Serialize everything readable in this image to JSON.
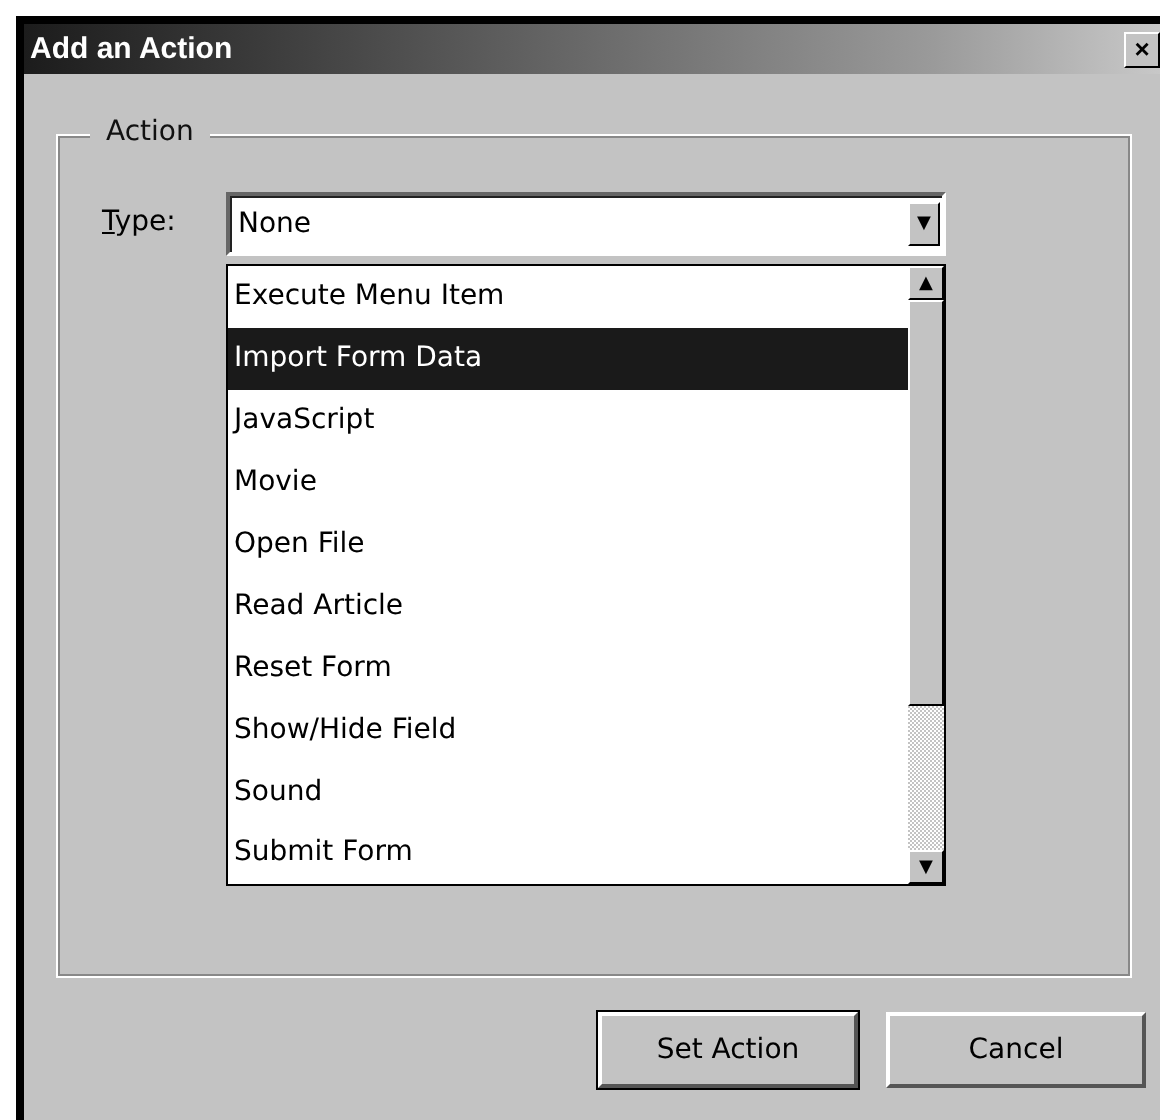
{
  "window": {
    "title": "Add an Action",
    "close": "×"
  },
  "group": {
    "legend": "Action"
  },
  "type_field": {
    "label": "Type:",
    "value": "None",
    "arrow": "▼"
  },
  "dropdown": {
    "up": "▲",
    "down": "▼",
    "items": [
      {
        "label": "Execute Menu Item",
        "selected": false
      },
      {
        "label": "Import Form Data",
        "selected": true
      },
      {
        "label": "JavaScript",
        "selected": false
      },
      {
        "label": "Movie",
        "selected": false
      },
      {
        "label": "Open File",
        "selected": false
      },
      {
        "label": "Read Article",
        "selected": false
      },
      {
        "label": "Reset Form",
        "selected": false
      },
      {
        "label": "Show/Hide Field",
        "selected": false
      },
      {
        "label": "Sound",
        "selected": false
      },
      {
        "label": "Submit Form",
        "selected": false
      }
    ]
  },
  "buttons": [
    {
      "label": "Set Action",
      "default": true
    },
    {
      "label": "Cancel",
      "default": false
    }
  ]
}
